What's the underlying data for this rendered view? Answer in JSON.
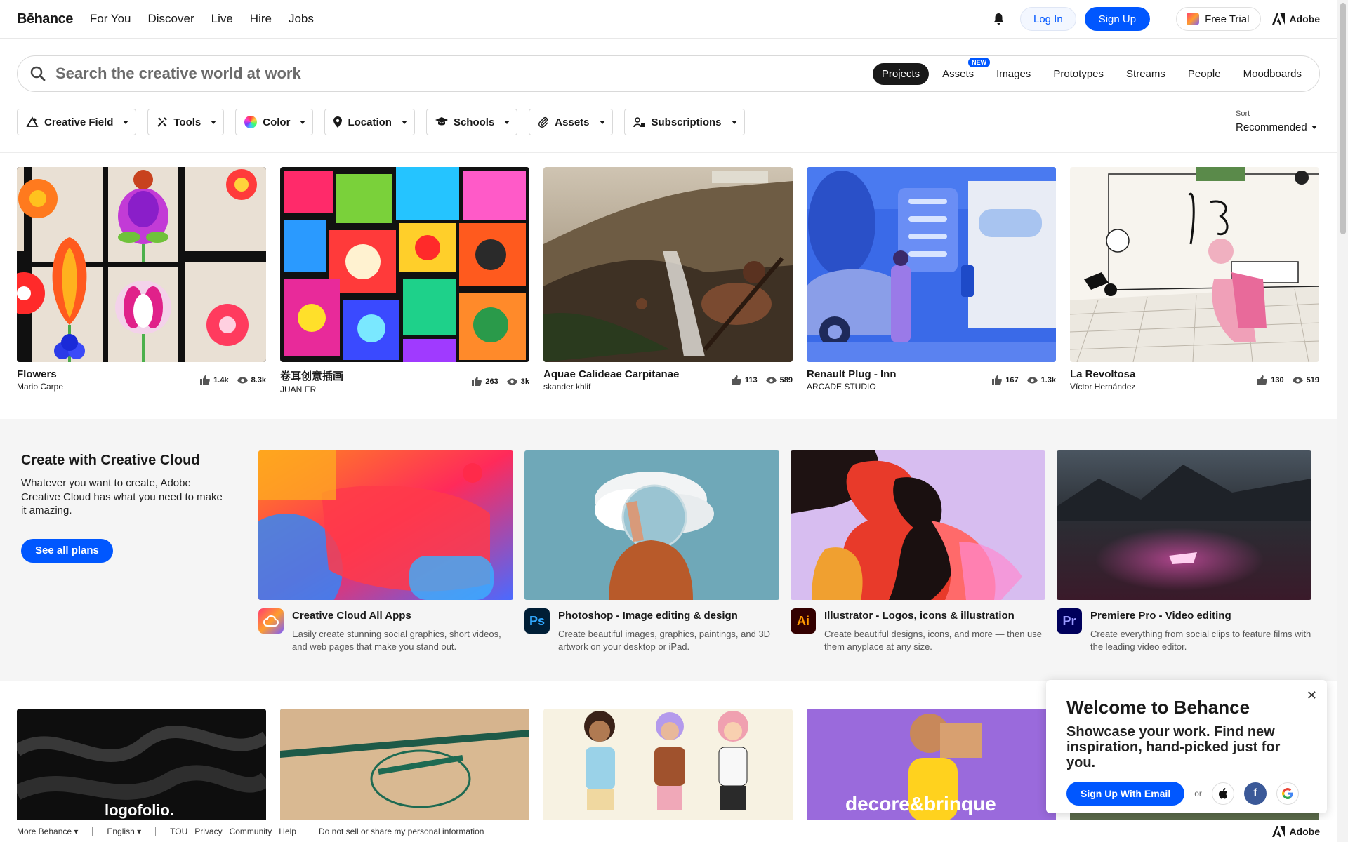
{
  "nav": {
    "logo": "Bēhance",
    "links": [
      "For You",
      "Discover",
      "Live",
      "Hire",
      "Jobs"
    ],
    "login": "Log In",
    "signup": "Sign Up",
    "free_trial": "Free Trial",
    "adobe": "Adobe"
  },
  "search": {
    "placeholder": "Search the creative world at work",
    "tabs": [
      {
        "label": "Projects",
        "active": true
      },
      {
        "label": "Assets",
        "badge": "NEW"
      },
      {
        "label": "Images"
      },
      {
        "label": "Prototypes"
      },
      {
        "label": "Streams"
      },
      {
        "label": "People"
      },
      {
        "label": "Moodboards"
      }
    ]
  },
  "filters": [
    "Creative Field",
    "Tools",
    "Color",
    "Location",
    "Schools",
    "Assets",
    "Subscriptions"
  ],
  "sort": {
    "label": "Sort",
    "value": "Recommended"
  },
  "projects": [
    {
      "title": "Flowers",
      "owner": "Mario Carpe",
      "likes": "1.4k",
      "views": "8.3k"
    },
    {
      "title": "卷耳创意插画",
      "owner": "JUAN ER",
      "likes": "263",
      "views": "3k"
    },
    {
      "title": "Aquae Calideae Carpitanae",
      "owner": "skander khlif",
      "likes": "113",
      "views": "589"
    },
    {
      "title": "Renault Plug - Inn",
      "owner": "ARCADE STUDIO",
      "likes": "167",
      "views": "1.3k"
    },
    {
      "title": "La Revoltosa",
      "owner": "Víctor Hernández",
      "likes": "130",
      "views": "519"
    }
  ],
  "creative_cloud": {
    "title": "Create with Creative Cloud",
    "description": "Whatever you want to create, Adobe Creative Cloud has what you need to make it amazing.",
    "button": "See all plans",
    "apps": [
      {
        "icon": "creative-cloud-icon",
        "short": "",
        "name": "Creative Cloud All Apps",
        "desc": "Easily create stunning social graphics, short videos, and web pages that make you stand out."
      },
      {
        "icon": "photoshop-icon",
        "short": "Ps",
        "name": "Photoshop - Image editing & design",
        "desc": "Create beautiful images, graphics, paintings, and 3D artwork on your desktop or iPad."
      },
      {
        "icon": "illustrator-icon",
        "short": "Ai",
        "name": "Illustrator - Logos, icons & illustration",
        "desc": "Create beautiful designs, icons, and more — then use them anyplace at any size."
      },
      {
        "icon": "premiere-icon",
        "short": "Pr",
        "name": "Premiere Pro - Video editing",
        "desc": "Create everything from social clips to feature films with the leading video editor."
      }
    ]
  },
  "bottom_row": {
    "logo_text": "logofolio.",
    "brand_text": "decore&brinque"
  },
  "footer": {
    "more": "More Behance",
    "language": "English",
    "links": [
      "TOU",
      "Privacy",
      "Community",
      "Help",
      "Do not sell or share my personal information"
    ],
    "adobe": "Adobe"
  },
  "welcome": {
    "title": "Welcome to Behance",
    "subtitle": "Showcase your work. Find new inspiration, hand-picked just for you.",
    "button": "Sign Up With Email",
    "or": "or"
  },
  "colors": {
    "accent": "#0057ff",
    "text": "#191919",
    "band": "#f5f5f5"
  }
}
